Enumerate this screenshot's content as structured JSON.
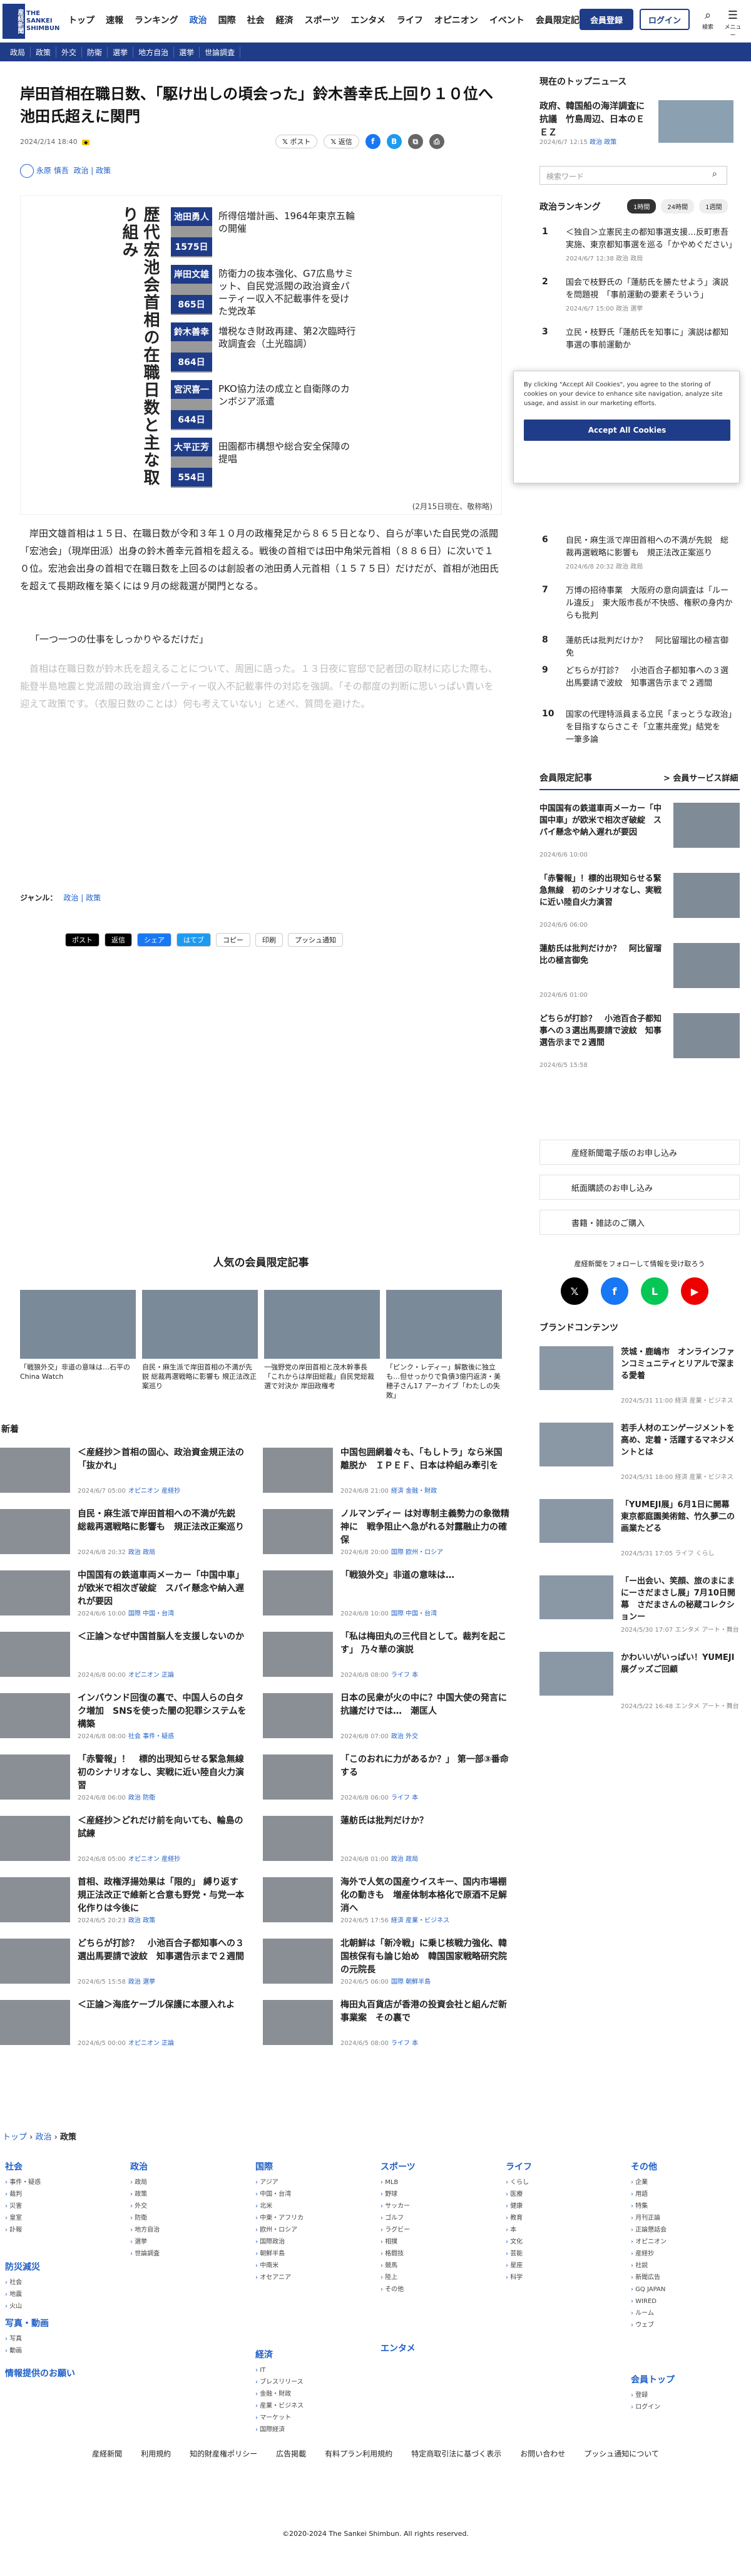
{
  "header": {
    "logo_ja": "産経新聞",
    "logo_en": "THE SANKEI SHIMBUN",
    "nav": [
      "トップ",
      "速報",
      "ランキング",
      "政治",
      "国際",
      "社会",
      "経済",
      "スポーツ",
      "エンタメ",
      "ライフ",
      "オピニオン",
      "イベント",
      "会員限定記事"
    ],
    "member_button": "会員登録",
    "login_button": "ログイン",
    "search_label": "検索",
    "menu_label": "メニュー",
    "subnav": [
      "政局",
      "政策",
      "外交",
      "防衛",
      "選挙",
      "地方自治",
      "選挙",
      "世論調査"
    ]
  },
  "article": {
    "title": "岸田首相在職日数、「駆け出しの頃会った」鈴木善幸氏上回り１０位へ　池田氏超えに関門",
    "date": "2024/2/14 18:40",
    "share_post": "ポスト",
    "share_x": "返信",
    "author": "永原 慎吾",
    "tags": "政治 | 政策",
    "infographic": {
      "title": "歴代宏池会首相の在職日数と主な取り組み",
      "rows": [
        {
          "name": "池田勇人",
          "days": "1575日",
          "note": "所得倍増計画、1964年東京五輪の開催"
        },
        {
          "name": "岸田文雄",
          "days": "865日",
          "note": "防衛力の抜本強化、G7広島サミット、自民党派閥の政治資金パーティー収入不記載事件を受けた党改革"
        },
        {
          "name": "鈴木善幸",
          "days": "864日",
          "note": "増税なき財政再建、第2次臨時行政調査会（土光臨調）"
        },
        {
          "name": "宮沢喜一",
          "days": "644日",
          "note": "PKO協力法の成立と自衛隊のカンボジア派遣"
        },
        {
          "name": "大平正芳",
          "days": "554日",
          "note": "田園都市構想や総合安全保障の提唱"
        }
      ],
      "caption": "(2月15日現在、敬称略)"
    },
    "body1": "岸田文雄首相は１５日、在職日数が令和３年１０月の政権発足から８６５日となり、自らが率いた自民党の派閥「宏池会」（現岸田派）出身の鈴木善幸元首相を超える。戦後の首相では田中角栄元首相（８８６日）に次いで１０位。宏池会出身の首相で在職日数を上回るのは創設者の池田勇人元首相（１５７５日）だけだが、首相が池田氏を超えて長期政権を築くには９月の総裁選が関門となる。",
    "quote": "「一つ一つの仕事をしっかりやるだけだ」",
    "body2": "首相は在職日数が鈴木氏を超えることについて、周囲に語った。１３日夜に官邸で記者団の取材に応じた際も、能登半島地震と党派閥の政治資金パーティー収入不記載事件の対応を強調。「その都度の判断に思いっぱい責いを迎えて政策です。（衣服日数のことは）何も考えていない」と述べ、質問を避けた。",
    "genre_label": "ジャンル：",
    "genre": "政治 | 政策",
    "share_bottom": [
      "ポスト",
      "返信",
      "シェア",
      "はてブ",
      "コピー",
      "印刷",
      "プッシュ通知"
    ]
  },
  "member_section": {
    "heading": "人気の会員限定記事",
    "items": [
      "「戦狼外交」非道の意味は…石平のChina Watch",
      "自民・麻生派で岸田首相の不満が先鋭 総裁再選戦略に影響も 規正法改正案巡り",
      "一強野党の岸田首相と茂木幹事長「これからは岸田総裁」自民党総裁選で対決か 岸田政権考",
      "「ピンク・レディー」解散後に独立も…但せっかりで負債3億円返済・美穂子さん17 アーカイブ「わたしの失敗」"
    ]
  },
  "news": {
    "heading": "新着",
    "items": [
      {
        "title": "＜産経抄＞首相の固心、政治資金規正法の「抜かれ」",
        "date": "2024/6/7 05:00",
        "cat": "オピニオン 産経抄"
      },
      {
        "title": "中国包囲網着々も、「もしトラ」なら米国離脱か　ＩＰＥＦ、日本は枠組み牽引を",
        "date": "2024/6/8 21:00",
        "cat": "経済 金融・財政"
      },
      {
        "title": "自民・麻生派で岸田首相への不満が先鋭　総裁再選戦略に影響も　規正法改正案巡り",
        "date": "2024/6/8 20:32",
        "cat": "政治 政局"
      },
      {
        "title": "ノルマンディー は対専制主義勢力の象徴精神に　戦争阻止へ急がれる対露融止力の確保",
        "date": "2024/6/8 20:00",
        "cat": "国際 欧州・ロシア"
      },
      {
        "title": "中国国有の鉄道車両メーカー「中国中車」が欧米で相次ぎ破綻　スパイ懸念や納入遅れが要因",
        "date": "2024/6/6 10:00",
        "cat": "国際 中国・台湾"
      },
      {
        "title": "「戦狼外交」非道の意味は…",
        "date": "2024/6/8 10:00",
        "cat": "国際 中国・台湾"
      },
      {
        "title": "＜正論＞なぜ中国首脳人を支援しないのか",
        "date": "2024/6/8 00:00",
        "cat": "オピニオン 正論"
      },
      {
        "title": "「私は梅田丸の三代目として。裁判を起こす」 乃々華の演説",
        "date": "2024/6/8 08:00",
        "cat": "ライフ 本"
      },
      {
        "title": "インバウンド回復の裏で、中国人らの白タク増加　SNSを使った闇の犯罪システムを構築",
        "date": "2024/6/8 08:00",
        "cat": "社会 事件・疑惑"
      },
      {
        "title": "日本の民衆が火の中に？中国大使の発言に抗議だけでは…　潮匡人",
        "date": "2024/6/8 07:00",
        "cat": "政治 外交"
      },
      {
        "title": "「赤警報」！　標的出現知らせる緊急無線　初のシナリオなし、実戦に近い陸自火力演習",
        "date": "2024/6/8 06:00",
        "cat": "政治 防衛"
      },
      {
        "title": "「このおれに力があるか？」 第一部③番命する",
        "date": "2024/6/8 06:00",
        "cat": "ライフ 本"
      },
      {
        "title": "＜産経抄＞どれだけ前を向いても、輪島の試練",
        "date": "2024/6/8 05:00",
        "cat": "オピニオン 産経抄"
      },
      {
        "title": "蓮舫氏は批判だけか？",
        "date": "2024/6/8 01:00",
        "cat": "政治 政局"
      },
      {
        "title": "首相、政権浮揚効果は「限的」 縛り返す　規正法改正で維新と合意も野党・与党一本化作りは今後に",
        "date": "2024/6/5 20:23",
        "cat": "政治 政策"
      },
      {
        "title": "海外で人気の国産ウイスキー、国内市場棚化の動きも　増産体制本格化で原酒不足解消へ",
        "date": "2024/6/5 17:56",
        "cat": "経済 産業・ビジネス"
      },
      {
        "title": "どちらが打診？　小池百合子都知事への３選出馬要請で波紋　知事選告示まで２週間",
        "date": "2024/6/5 15:58",
        "cat": "政治 選挙"
      },
      {
        "title": "北朝鮮は「新冷戦」に乗じ核戦力強化、韓国核保有も論じ始め　韓国国家戦略研究院の元院長",
        "date": "2024/6/5 06:00",
        "cat": "国際 朝鮮半島"
      },
      {
        "title": "＜正論＞海底ケーブル保護に本腰入れよ",
        "date": "2024/6/5 00:00",
        "cat": "オピニオン 正論"
      },
      {
        "title": "梅田丸百貨店が香港の投資会社と組んだ新事業案　その裏で",
        "date": "2024/6/5 08:00",
        "cat": "ライフ 本"
      }
    ]
  },
  "sidebar": {
    "topic_heading": "現在のトップニュース",
    "topic_title": "政府、韓国船の海洋調査に抗議　竹島周辺、日本のＥＥＺ",
    "topic_date": "2024/6/7 12:15",
    "topic_cat": "政治 政策",
    "search_placeholder": "検索ワード",
    "ranking_heading": "政治ランキング",
    "ranking_tabs": [
      "1時間",
      "24時間",
      "1週間"
    ],
    "ranking": [
      {
        "num": "1",
        "title": "＜独自＞立憲民主の都知事選支援…反町恵吾実施、東京都知事選を巡る「かやめぐださい」",
        "date": "2024/6/7 12:38",
        "cat": "政治 政局"
      },
      {
        "title": "国会で枝野氏の「蓮舫氏を勝たせよう」演説を問題視　「事前運動の要素そういう」",
        "num": "2",
        "date": "2024/6/7 15:00",
        "cat": "政治 選挙"
      },
      {
        "num": "3",
        "title": "立民・枝野氏「蓮舫氏を知事に」演説は都知事選の事前運動か　",
        "date": "",
        "cat": ""
      },
      {
        "num": "6",
        "title": "自民・麻生派で岸田首相への不満が先鋭　総裁再選戦略に影響も　規正法改正案巡り",
        "date": "2024/6/8 20:32",
        "cat": "政治 政局"
      },
      {
        "num": "7",
        "title": "万博の招待事業　大阪府の意向調査は「ルール違反」　東大阪市長が不快感、権釈の身内からも批判",
        "date": "",
        "cat": ""
      },
      {
        "num": "8",
        "title": "蓮舫氏は批判だけか？　阿比留瑠比の極言御免",
        "date": "",
        "cat": ""
      },
      {
        "num": "9",
        "title": "どちらが打診？　小池百合子都知事への３選出馬要請で波紋　知事選告示まで２週間",
        "date": "",
        "cat": ""
      },
      {
        "num": "10",
        "title": "国家の代理特派員まる立民「まっとうな政治」を目指すならさこそ「立憲共産党」結党を　一筆多論",
        "date": "",
        "cat": ""
      }
    ],
    "cookie_text": "By clicking \"Accept All Cookies\", you agree to the storing of cookies on your device to enhance site navigation, analyze site usage, and assist in our marketing efforts.",
    "cookie_button": "Accept All Cookies",
    "member_heading": "会員限定記事",
    "member_more": "> 会員サービス詳細",
    "member_items": [
      {
        "title": "中国国有の鉄道車両メーカー「中国中車」が欧米で相次ぎ破綻　スパイ懸念や納入遅れが要因",
        "date": "2024/6/6 10:00"
      },
      {
        "title": "「赤警報」！標的出現知らせる緊急無線　初のシナリオなし、実戦に近い陸自火力演習",
        "date": "2024/6/6 06:00"
      },
      {
        "title": "蓮舫氏は批判だけか？　阿比留瑠比の極言御免",
        "date": "2024/6/6 01:00"
      },
      {
        "title": "どちらが打診？　小池百合子都知事への３選出馬要請で波紋　知事選告示まで２週間",
        "date": "2024/6/5 15:58"
      }
    ],
    "links": [
      "産経新聞電子版のお申し込み",
      "紙面購読のお申し込み",
      "書籍・雑誌のご購入"
    ],
    "follow_text": "産経新聞をフォローして情報を受け取ろう",
    "brand_heading": "ブランドコンテンツ",
    "brand_items": [
      {
        "title": "茨城・鹿嶋市　オンラインファンコミュニティとリアルで深まる愛着",
        "meta": "2024/5/31 11:00 経済 産業・ビジネス"
      },
      {
        "title": "若手人材のエンゲージメントを高め、定着・活躍するマネジメントとは",
        "meta": "2024/5/31 18:00 経済 産業・ビジネス"
      },
      {
        "title": "「YUMEJI展」6月1日に開幕 東京都庭園美術館、竹久夢二の画業たどる",
        "meta": "2024/5/31 17:05 ライフ くらし"
      },
      {
        "title": "「ー出会い、笑顔、旅のまにまにーさだまさし展」7月10日開幕　さだまさんの秘蔵コレクションー",
        "meta": "2024/5/30 17:07 エンタメ アート・舞台"
      },
      {
        "title": "かわいいがいっぱい！YUMEJI展グッズご回顧",
        "meta": "2024/5/22 16:48 エンタメ アート・舞台"
      }
    ]
  },
  "footer": {
    "breadcrumb": [
      "トップ",
      "政治",
      "政策"
    ],
    "columns": [
      {
        "head": "社会",
        "items": [
          "事件・疑惑",
          "裁判",
          "災害",
          "皇室",
          "訃報"
        ]
      },
      {
        "head": "防災減災",
        "items": [
          "社会",
          "地震",
          "火山"
        ]
      },
      {
        "head": "写真・動画",
        "items": [
          "写真",
          "動画"
        ]
      },
      {
        "head": "情報提供のお願い",
        "items": []
      },
      {
        "head": "政治",
        "items": [
          "政局",
          "政策",
          "外交",
          "防衛",
          "地方自治",
          "選挙",
          "世論調査"
        ]
      },
      {
        "head": "国際",
        "items": [
          "アジア",
          "中国・台湾",
          "北米",
          "中東・アフリカ",
          "欧州・ロシア",
          "国際政治",
          "朝鮮半島",
          "中南米",
          "オセアニア"
        ]
      },
      {
        "head": "経済",
        "items": [
          "IT",
          "ブレスリリース",
          "金融・財政",
          "産業・ビジネス",
          "マーケット",
          "国際経済"
        ]
      },
      {
        "head": "スポーツ",
        "items": [
          "MLB",
          "野球",
          "サッカー",
          "ゴルフ",
          "ラグビー",
          "相撲",
          "格闘技",
          "競馬",
          "陸上",
          "その他"
        ]
      },
      {
        "head": "エンタメ",
        "items": []
      },
      {
        "head": "ライフ",
        "items": [
          "くらし",
          "医療",
          "健康",
          "教育",
          "本",
          "文化",
          "芸能",
          "星座",
          "科学"
        ]
      },
      {
        "head": "その他",
        "items": [
          "企業",
          "用語",
          "特集",
          "月刊正論",
          "正論懇話会",
          "オピニオン",
          "産経抄",
          "社説",
          "新聞広告",
          "GQ JAPAN",
          "WIRED",
          "ルーム",
          "ウェブ"
        ]
      },
      {
        "head": "会員トップ",
        "items": [
          "登録",
          "ログイン"
        ]
      }
    ],
    "bar": [
      "産経新聞",
      "利用規約",
      "知的財産権ポリシー",
      "広告掲載",
      "有料プラン利用規約",
      "特定商取引法に基づく表示",
      "お問い合わせ",
      "プッシュ通知について"
    ],
    "copyright": "©2020-2024 The Sankei Shimbun. All rights reserved."
  }
}
